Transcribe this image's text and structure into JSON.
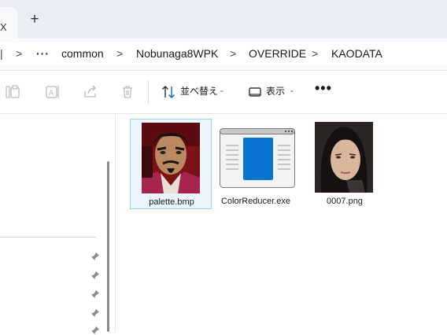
{
  "tabs": {
    "close_glyph": "X",
    "new_tab_glyph": "+"
  },
  "breadcrumb": {
    "overflow": "···",
    "separator": ">",
    "parts": [
      "common",
      "Nobunaga8WPK",
      "OVERRIDE",
      "KAODATA"
    ]
  },
  "toolbar": {
    "sort_label": "並べ替え",
    "view_label": "表示",
    "more_glyph": "•••"
  },
  "files": [
    {
      "name": "palette.bmp",
      "selected": true,
      "icon": "portrait-man-thumbnail"
    },
    {
      "name": "ColorReducer.exe",
      "selected": false,
      "icon": "application-icon"
    },
    {
      "name": "0007.png",
      "selected": false,
      "icon": "portrait-woman-thumbnail"
    }
  ],
  "colors": {
    "accent": "#0a74d1",
    "selection_border": "#99d1f0",
    "selection_fill": "#eaf5fd",
    "tabstrip_bg": "#e9eef4"
  }
}
